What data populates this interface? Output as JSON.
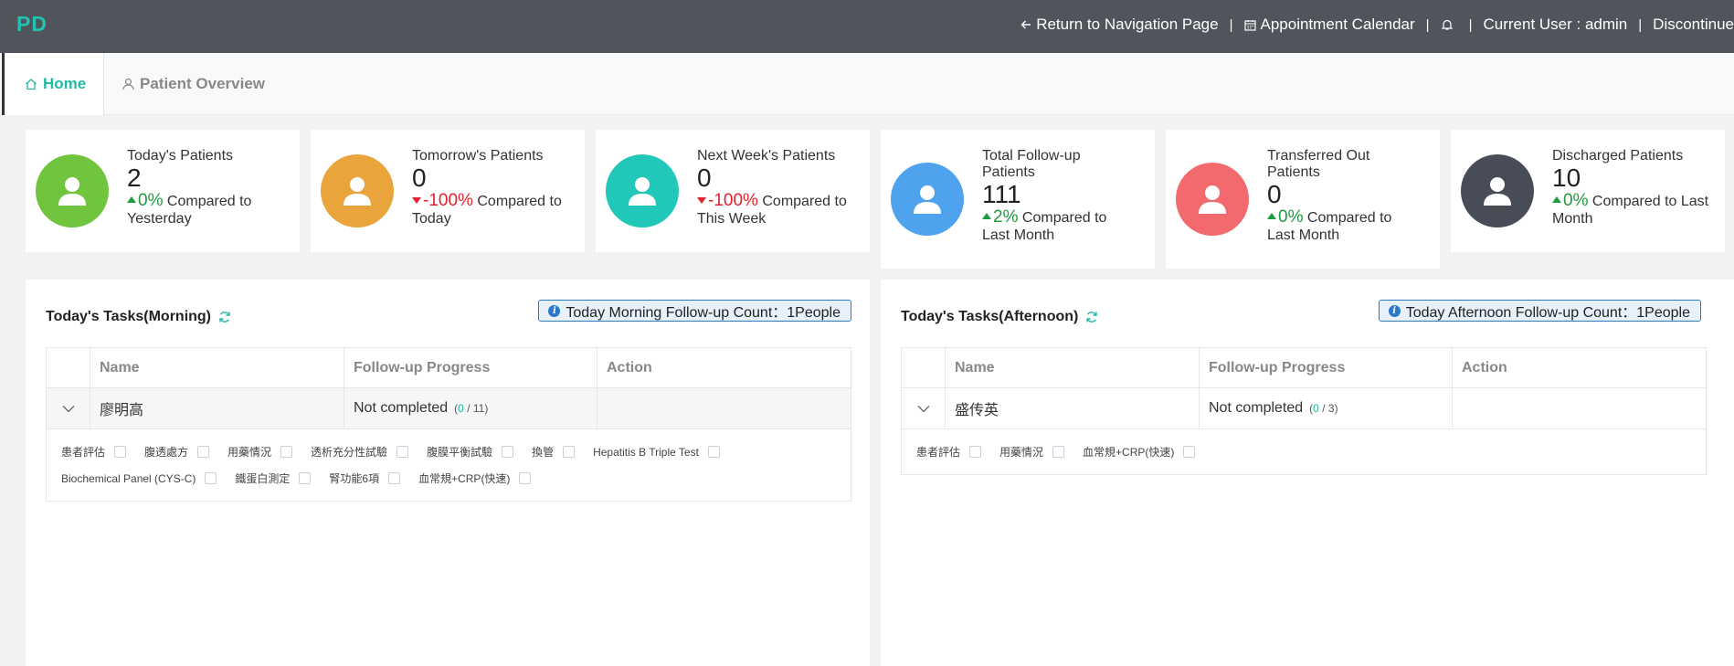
{
  "header": {
    "logo": "PD",
    "nav": {
      "return_label": "Return to Navigation Page",
      "calendar_label": "Appointment Calendar",
      "separator": "|",
      "user_label": "Current User : admin",
      "discontinue_label": "Discontinue"
    }
  },
  "tabs": {
    "home": "Home",
    "overview": "Patient Overview"
  },
  "colors": {
    "accent": "#22b9a5",
    "header_bg": "#50555c",
    "up": "#1e9b3c",
    "down": "#e2222e"
  },
  "stats": [
    {
      "title": "Today's Patients",
      "value": "2",
      "trend": "up",
      "percent": "0%",
      "compare": "Compared to Yesterday",
      "color": "#71c43d"
    },
    {
      "title": "Tomorrow's Patients",
      "value": "0",
      "trend": "down",
      "percent": "-100%",
      "compare": "Compared to Today",
      "color": "#e9a43b"
    },
    {
      "title": "Next Week's Patients",
      "value": "0",
      "trend": "down",
      "percent": "-100%",
      "compare": "Compared to This Week",
      "color": "#21c7b8"
    },
    {
      "title": "Total Follow-up Patients",
      "value": "111",
      "trend": "up",
      "percent": "2%",
      "compare": "Compared to Last Month",
      "color": "#4ea2ee"
    },
    {
      "title": "Transferred Out Patients",
      "value": "0",
      "trend": "up",
      "percent": "0%",
      "compare": "Compared to Last Month",
      "color": "#f26a6e"
    },
    {
      "title": "Discharged Patients",
      "value": "10",
      "trend": "up",
      "percent": "0%",
      "compare": "Compared to Last Month",
      "color": "#474c57"
    }
  ],
  "morning": {
    "title": "Today's Tasks(Morning)",
    "count_label": "Today Morning Follow-up Count：1People",
    "columns": {
      "name": "Name",
      "progress": "Follow-up Progress",
      "action": "Action"
    },
    "row": {
      "name": "廖明高",
      "status": "Not completed",
      "open": "(",
      "done": "0",
      "slash": " / ",
      "total": "11",
      "close": ")"
    },
    "items": [
      "患者評估",
      "腹透處方",
      "用藥情況",
      "透析充分性試驗",
      "腹膜平衡試驗",
      "換管",
      "Hepatitis B Triple Test",
      "Biochemical Panel (CYS-C)",
      "鐵蛋白測定",
      "腎功能6項",
      "血常規+CRP(快速)"
    ]
  },
  "afternoon": {
    "title": "Today's Tasks(Afternoon)",
    "count_label": "Today Afternoon Follow-up Count：1People",
    "columns": {
      "name": "Name",
      "progress": "Follow-up Progress",
      "action": "Action"
    },
    "row": {
      "name": "盛传英",
      "status": "Not completed",
      "open": "(",
      "done": "0",
      "slash": " / ",
      "total": "3",
      "close": ")"
    },
    "items": [
      "患者評估",
      "用藥情況",
      "血常規+CRP(快速)"
    ]
  }
}
